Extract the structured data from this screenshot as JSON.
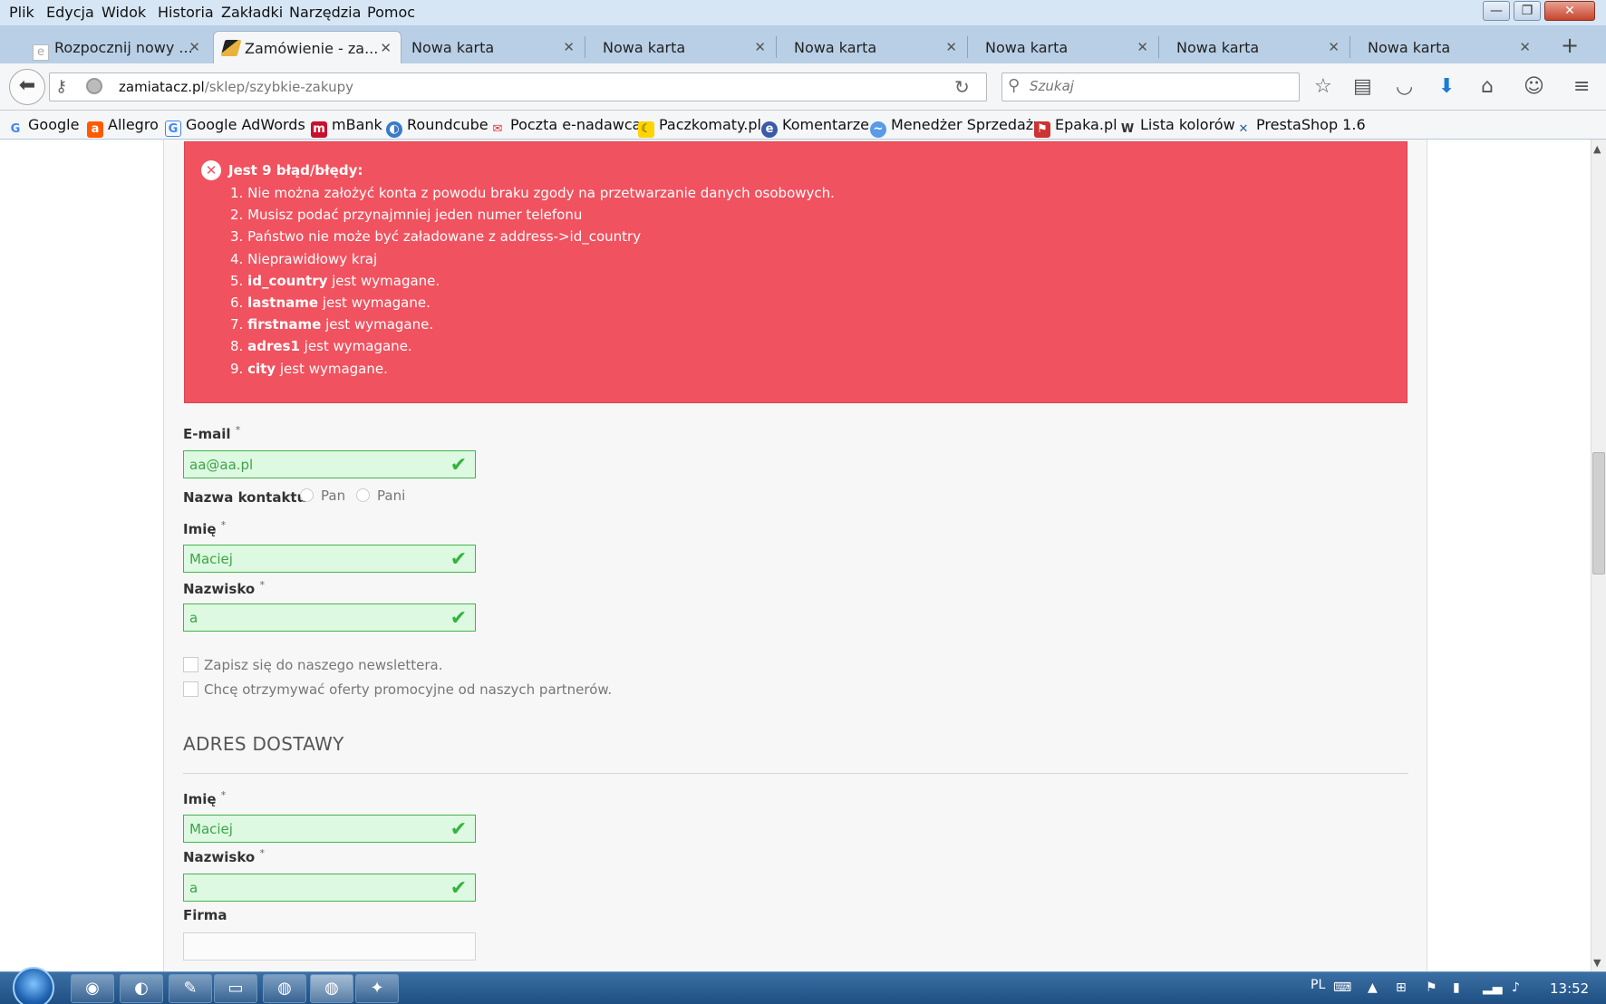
{
  "menu": [
    "Plik",
    "Edycja",
    "Widok",
    "Historia",
    "Zakładki",
    "Narzędzia",
    "Pomoc"
  ],
  "window_controls": {
    "minimize": "—",
    "maximize": "❐",
    "close": "✕"
  },
  "tabs": [
    {
      "label": "Rozpocznij nowy ..."
    },
    {
      "label": "Zamówienie - za...",
      "active": true
    },
    {
      "label": "Nowa karta"
    },
    {
      "label": "Nowa karta"
    },
    {
      "label": "Nowa karta"
    },
    {
      "label": "Nowa karta"
    },
    {
      "label": "Nowa karta"
    },
    {
      "label": "Nowa karta"
    }
  ],
  "new_tab": "+",
  "address": {
    "host": "zamiatacz.pl",
    "path": "/sklep/szybkie-zakupy"
  },
  "search": {
    "placeholder": "Szukaj"
  },
  "bookmarks": [
    "Google",
    "Allegro",
    "Google AdWords",
    "mBank",
    "Roundcube",
    "Poczta e-nadawca",
    "Paczkomaty.pl",
    "Komentarze",
    "Menedżer Sprzedaży",
    "Epaka.pl",
    "Lista kolorów",
    "PrestaShop 1.6"
  ],
  "errors": {
    "title": "Jest 9 błąd/błędy:",
    "items": [
      {
        "num": "1.",
        "bold": "",
        "text": "Nie można założyć konta z powodu braku zgody na przetwarzanie danych osobowych."
      },
      {
        "num": "2.",
        "bold": "",
        "text": "Musisz podać przynajmniej jeden numer telefonu"
      },
      {
        "num": "3.",
        "bold": "",
        "text": "Państwo nie może być załadowane z address->id_country"
      },
      {
        "num": "4.",
        "bold": "",
        "text": "Nieprawidłowy kraj"
      },
      {
        "num": "5.",
        "bold": "id_country",
        "text": " jest wymagane."
      },
      {
        "num": "6.",
        "bold": "lastname",
        "text": " jest wymagane."
      },
      {
        "num": "7.",
        "bold": "firstname",
        "text": " jest wymagane."
      },
      {
        "num": "8.",
        "bold": "adres1",
        "text": " jest wymagane."
      },
      {
        "num": "9.",
        "bold": "city",
        "text": " jest wymagane."
      }
    ]
  },
  "form": {
    "email_label": "E-mail",
    "email_value": "aa@aa.pl",
    "contact_label": "Nazwa kontaktu",
    "radio_pan": "Pan",
    "radio_pani": "Pani",
    "firstname_label": "Imię",
    "firstname_value": "Maciej",
    "lastname_label": "Nazwisko",
    "lastname_value": "a",
    "newsletter_label": "Zapisz się do naszego newslettera.",
    "offers_label": "Chcę otrzymywać oferty promocyjne od naszych partnerów.",
    "required_mark": "*"
  },
  "delivery": {
    "section_title": "ADRES DOSTAWY",
    "firstname_label": "Imię",
    "firstname_value": "Maciej",
    "lastname_label": "Nazwisko",
    "lastname_value": "a",
    "company_label": "Firma",
    "company_value": ""
  },
  "taskbar": {
    "language": "PL",
    "clock": "13:52"
  },
  "colors": {
    "error_bg": "#f1525f",
    "valid_bg": "#ddf9e1",
    "valid_border": "#45b44d",
    "check": "#35b33f"
  }
}
